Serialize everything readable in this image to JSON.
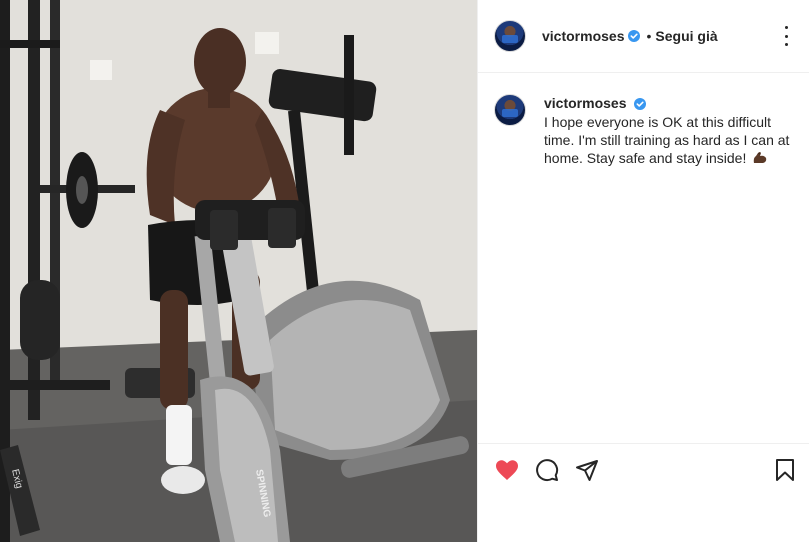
{
  "post": {
    "username": "victormoses",
    "verified": true,
    "separator": "•",
    "follow_status": "Segui già",
    "caption": {
      "username": "victormoses",
      "text": "I hope everyone is OK at this difficult time. I'm still training as hard as I can at home. Stay safe and stay inside!",
      "emoji": "flexed-biceps-emoji"
    },
    "liked": true
  },
  "photo": {
    "equipment_text": {
      "bike_brand": "SPINNING",
      "mat_brand": "Exig"
    }
  },
  "colors": {
    "like_red": "#ed4956",
    "verified_blue": "#3897f0",
    "text": "#262626",
    "border": "#efefef"
  },
  "icons": [
    "heart-icon",
    "comment-icon",
    "share-icon",
    "bookmark-icon",
    "more-options-icon",
    "verified-badge-icon"
  ]
}
